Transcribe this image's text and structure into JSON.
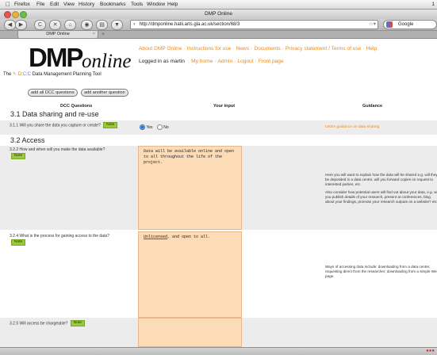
{
  "menubar": {
    "apple": "",
    "menus": [
      "Firefox",
      "File",
      "Edit",
      "View",
      "History",
      "Bookmarks",
      "Tools",
      "Window",
      "Help"
    ],
    "clock": "1"
  },
  "window": {
    "title": "DMP Online"
  },
  "nav": {
    "back": "◀",
    "forward": "▶",
    "reload": "C",
    "stop": "✕",
    "home": "⌂",
    "url": "http://dmponline.hatii.arts.gla.ac.uk/section/68/3",
    "search_placeholder": "Google"
  },
  "tab": {
    "label": "DMP Online",
    "close": "×",
    "new": "+"
  },
  "logo": {
    "dmp": "DMP",
    "online": "online",
    "sub_the": "The",
    "sub_d": "D",
    "sub_c1": "C",
    "sub_c2": "C",
    "sub_rest": "Data Management Planning Tool"
  },
  "topnav": {
    "links": [
      "About DMP Online",
      "Instructions for use",
      "News",
      "Documents",
      "Privacy statement / Terms of use",
      "Help"
    ]
  },
  "login": {
    "text": "Logged in as martin",
    "links": [
      "My home",
      "Admin",
      "Logout",
      "Front page"
    ]
  },
  "buttons": {
    "add_all": "add all DCC questions",
    "add_another": "add another question"
  },
  "columns": {
    "q": "DCC Questions",
    "input": "Your input",
    "guidance": "Guidance"
  },
  "sections": [
    {
      "title": "3.1 Data sharing and re-use",
      "questions": [
        {
          "text": "3.1.1 Will you share the data you capture or create?",
          "note": "Note",
          "radio_yes": "Yes",
          "radio_no": "No",
          "guidance_link": "UKDA guidance on data sharing"
        }
      ]
    },
    {
      "title": "3.2 Access",
      "questions": [
        {
          "text": "3.2.2 How and when will you make the data available?",
          "note": "Note",
          "answer": "Data will be available online and open to all throughout the life of the project.",
          "guidance_p1": "Here you will want to explain how the data will be shared e.g. will they be deposited in a data centre, will you forward copies on request to interested parties, etc.",
          "guidance_p2": "Also consider how potential users will find out about your data, e.g. will you publish details of your research, present at conferences, blog about your findings, promote your research outputs on a website? etc."
        },
        {
          "text": "3.2.4 What is the process for gaining access to the data?",
          "note": "Note",
          "answer_word": "Unlicensed",
          "answer_rest": ", and open to all.",
          "guidance_p1": "Ways of accessing data include: downloading from a data centre; requesting direct from the researcher; downloading from a simple Web page."
        },
        {
          "text": "3.2.5 Will access be chargeable?",
          "note": "Note"
        }
      ]
    }
  ],
  "colors": {
    "accent": "#e6891f",
    "answer_bg": "#fbdcb6",
    "note_green": "#9ac93c"
  }
}
